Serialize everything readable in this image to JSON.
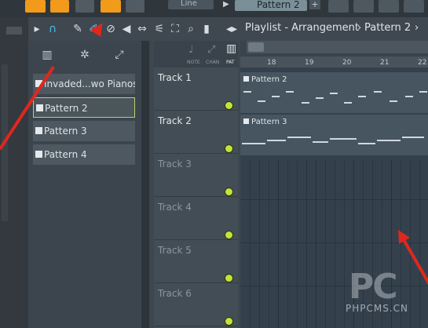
{
  "topbar": {
    "line_select": "Line",
    "pattern_selector": "Pattern 2",
    "add_label": "+"
  },
  "toolbar": {
    "breadcrumb_title": "Playlist - Arrangement",
    "breadcrumb_sep": "›",
    "breadcrumb_pattern": "Pattern 2"
  },
  "picker": {
    "patterns": [
      {
        "label": "Invaded...wo Pianos)",
        "selected": false
      },
      {
        "label": "Pattern 2",
        "selected": true
      },
      {
        "label": "Pattern 3",
        "selected": false
      },
      {
        "label": "Pattern 4",
        "selected": false
      }
    ]
  },
  "track_header": {
    "labels": [
      "NOTE",
      "CHAN",
      "PAT"
    ]
  },
  "timeline": {
    "bars": [
      "18",
      "19",
      "20",
      "21",
      "22"
    ]
  },
  "tracks": [
    {
      "name": "Track 1"
    },
    {
      "name": "Track 2"
    },
    {
      "name": "Track 3"
    },
    {
      "name": "Track 4"
    },
    {
      "name": "Track 5"
    },
    {
      "name": "Track 6"
    }
  ],
  "clips": [
    {
      "label": "Pattern 2"
    },
    {
      "label": "Pattern 3"
    }
  ],
  "watermark": {
    "logo": "PC",
    "text": "PHPCMS.CN"
  },
  "colors": {
    "accent_green": "#c7e23d",
    "arrow_red": "#e0271d",
    "orange_button": "#f29a1a"
  }
}
